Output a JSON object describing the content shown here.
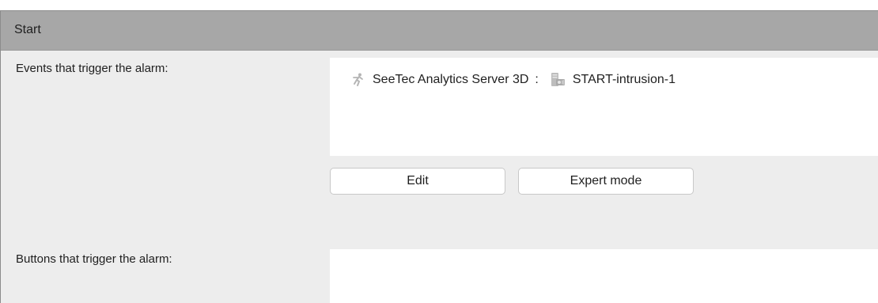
{
  "header": {
    "title": "Start"
  },
  "events": {
    "label": "Events that trigger the alarm:",
    "items": [
      {
        "source": "SeeTec Analytics Server 3D",
        "separator": ":",
        "name": "START-intrusion-1",
        "source_icon": "running-person-icon",
        "name_icon": "server-camera-icon"
      }
    ]
  },
  "actions": {
    "edit_label": "Edit",
    "expert_label": "Expert mode"
  },
  "buttons": {
    "label": "Buttons that trigger the alarm:"
  }
}
